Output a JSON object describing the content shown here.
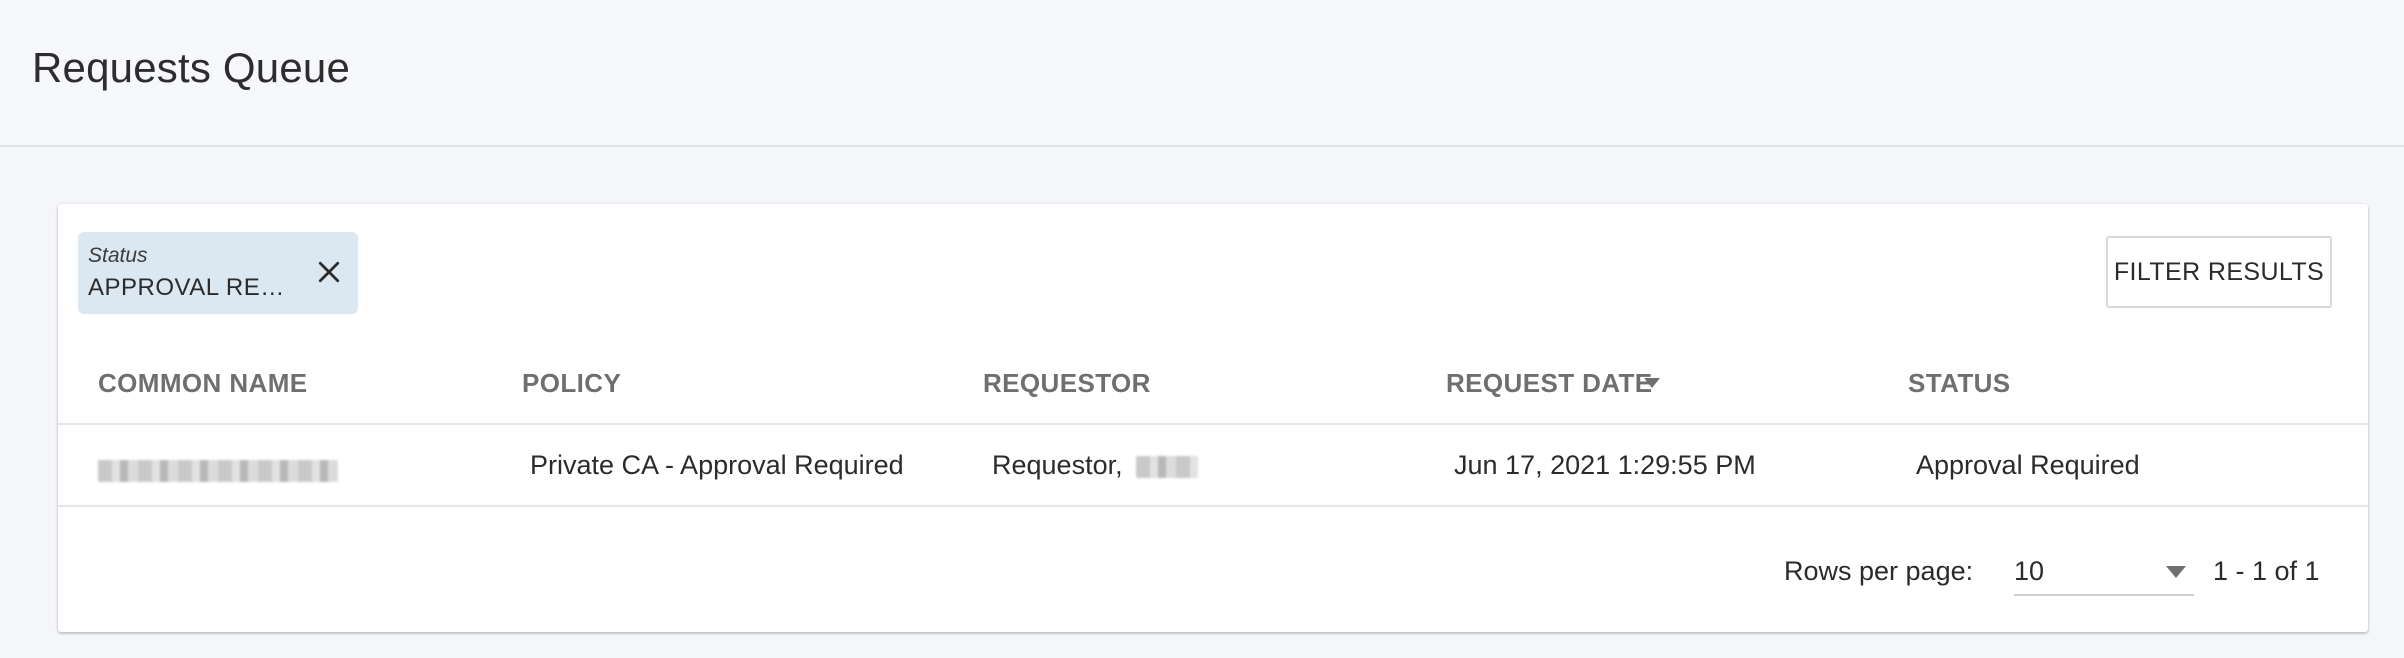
{
  "header": {
    "title": "Requests Queue"
  },
  "filter_chip": {
    "label": "Status",
    "value": "APPROVAL REQ..."
  },
  "toolbar": {
    "filter_label": "FILTER RESULTS"
  },
  "table": {
    "columns": [
      "COMMON NAME",
      "POLICY",
      "REQUESTOR",
      "REQUEST DATE",
      "STATUS"
    ],
    "sort_column": "REQUEST DATE",
    "rows": [
      {
        "policy": "Private CA - Approval Required",
        "requestor": "Requestor,",
        "request_date": "Jun 17, 2021 1:29:55 PM",
        "status": "Approval Required"
      }
    ]
  },
  "pagination": {
    "rows_per_page_label": "Rows per page:",
    "rows_per_page": "10",
    "range": "1 - 1 of 1"
  }
}
